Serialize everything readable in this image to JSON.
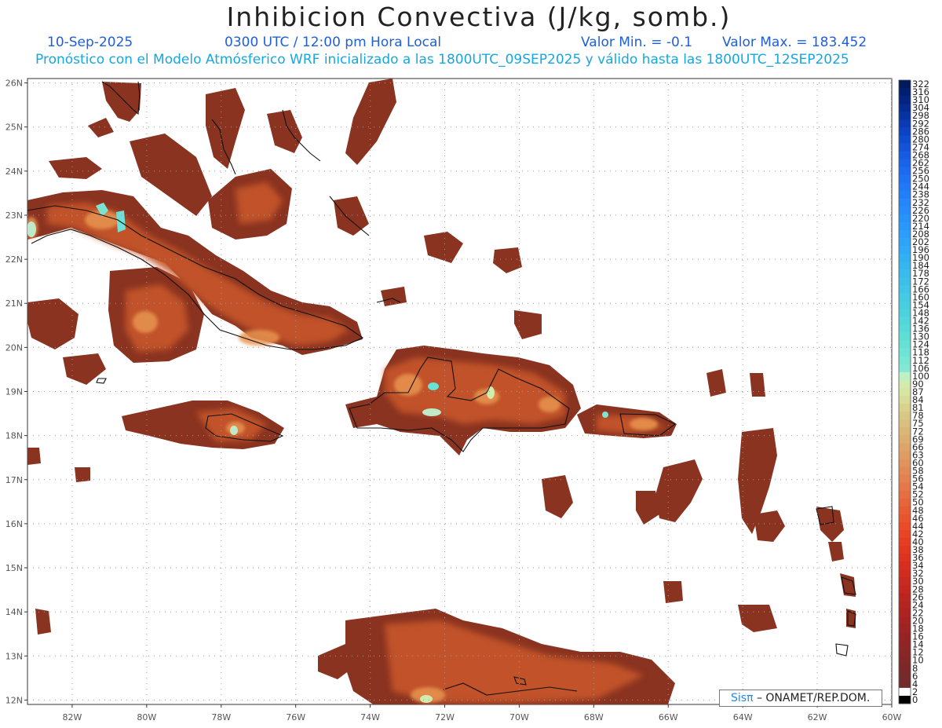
{
  "title": "Inhibicion Convectiva (J/kg, somb.)",
  "header": {
    "date": "10-Sep-2025",
    "time": "0300 UTC / 12:00 pm Hora Local",
    "value_min_label": "Valor Min. = -0.1",
    "value_max_label": "Valor Max. = 183.452",
    "model_line": "Pronóstico con el Modelo Atmósferico WRF inicializado a las 1800UTC_09SEP2025 y válido hasta las  1800UTC_12SEP2025"
  },
  "field": {
    "name": "Inhibicion Convectiva",
    "units": "J/kg",
    "min": -0.1,
    "max": 183.452
  },
  "map": {
    "lon_range": [
      -83.2,
      -60.0
    ],
    "lat_range": [
      11.9,
      26.1
    ],
    "lat_ticks": [
      "12N",
      "13N",
      "14N",
      "15N",
      "16N",
      "17N",
      "18N",
      "19N",
      "20N",
      "21N",
      "22N",
      "23N",
      "24N",
      "25N",
      "26N"
    ],
    "lon_ticks": [
      "82W",
      "80W",
      "78W",
      "76W",
      "74W",
      "72W",
      "70W",
      "68W",
      "66W",
      "64W",
      "62W",
      "60W"
    ],
    "grid": "dotted",
    "colors": {
      "cin_dark": "#7e2f20",
      "cin_mid": "#b84b25",
      "cin_light": "#e18d4c",
      "cin_high": "#bfe9c9",
      "cin_peak": "#63e4d6"
    }
  },
  "colorbar": {
    "labels": [
      "322",
      "316",
      "310",
      "304",
      "298",
      "292",
      "286",
      "280",
      "274",
      "268",
      "262",
      "256",
      "250",
      "244",
      "238",
      "232",
      "226",
      "220",
      "214",
      "208",
      "202",
      "196",
      "190",
      "184",
      "178",
      "172",
      "166",
      "160",
      "154",
      "148",
      "142",
      "136",
      "130",
      "124",
      "118",
      "112",
      "106",
      "100",
      "90",
      "87",
      "84",
      "81",
      "78",
      "75",
      "72",
      "69",
      "66",
      "63",
      "60",
      "58",
      "56",
      "54",
      "52",
      "50",
      "48",
      "46",
      "44",
      "42",
      "40",
      "38",
      "36",
      "34",
      "32",
      "30",
      "28",
      "26",
      "24",
      "22",
      "20",
      "18",
      "16",
      "14",
      "12",
      "10",
      "8",
      "6",
      "4",
      "2",
      "0"
    ],
    "colors": [
      "#011a5e",
      "#021f6f",
      "#03247f",
      "#062b91",
      "#0833a3",
      "#0a3bb4",
      "#0d43c2",
      "#104bce",
      "#1353d8",
      "#165be1",
      "#1963e8",
      "#1c6bee",
      "#1f73f3",
      "#2179f6",
      "#237ff8",
      "#2486fa",
      "#268cfb",
      "#2892fb",
      "#2a98fa",
      "#2c9ef9",
      "#2ea4f7",
      "#30aaf5",
      "#33b0f2",
      "#36b5ef",
      "#39bbec",
      "#3cc0e9",
      "#40c5e6",
      "#44cae3",
      "#48cee0",
      "#4dd2dd",
      "#52d6da",
      "#58dad8",
      "#5fded6",
      "#67e1d5",
      "#70e4d4",
      "#7ae6d4",
      "#85e8d4",
      "#bff0c4",
      "#d2ecb0",
      "#d7e4a2",
      "#d8dc98",
      "#d8d28d",
      "#d9c885",
      "#dac07e",
      "#dbb777",
      "#dcae70",
      "#dea56a",
      "#df9c63",
      "#e0935d",
      "#e28a56",
      "#e3814f",
      "#e47848",
      "#e56f41",
      "#e6663a",
      "#e75d33",
      "#e8552d",
      "#e94d28",
      "#e84524",
      "#e53e22",
      "#e13820",
      "#dc331f",
      "#d62f1f",
      "#d02c1f",
      "#c9291f",
      "#c22720",
      "#bb2520",
      "#b42421",
      "#ad2322",
      "#a52323",
      "#9e2324",
      "#972425",
      "#902526",
      "#892627",
      "#822728",
      "#7c2829",
      "#772a2b",
      "#722b2c",
      "#ffffff"
    ]
  },
  "credit": {
    "logo": "Sisπ",
    "text": "– ONAMET/REP.DOM."
  }
}
